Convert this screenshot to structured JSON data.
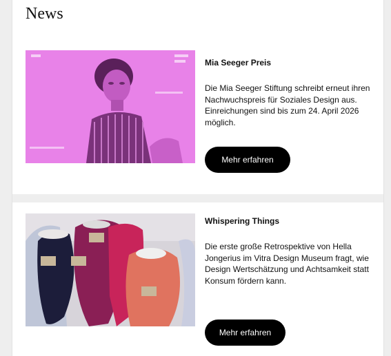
{
  "section": {
    "title": "News"
  },
  "items": [
    {
      "title": "Mia Seeger Preis",
      "body": "Die Mia Seeger Stiftung schreibt erneut ihren Nachwuchspreis für Soziales Design aus. Einreichungen sind bis zum 24. April 2026 möglich.",
      "button_label": "Mehr erfahren"
    },
    {
      "title": "Whispering Things",
      "body": "Die erste große Retrospektive von Hella Jongerius im Vitra Design Museum fragt, wie Design Wertschätzung und Achtsamkeit statt Konsum fördern kann.",
      "button_label": "Mehr erfahren"
    }
  ],
  "colors": {
    "page_bg": "#eeeeee",
    "card_bg": "#ffffff",
    "button_bg": "#000000",
    "button_text": "#ffffff",
    "image1_tint": "#e680e6"
  }
}
